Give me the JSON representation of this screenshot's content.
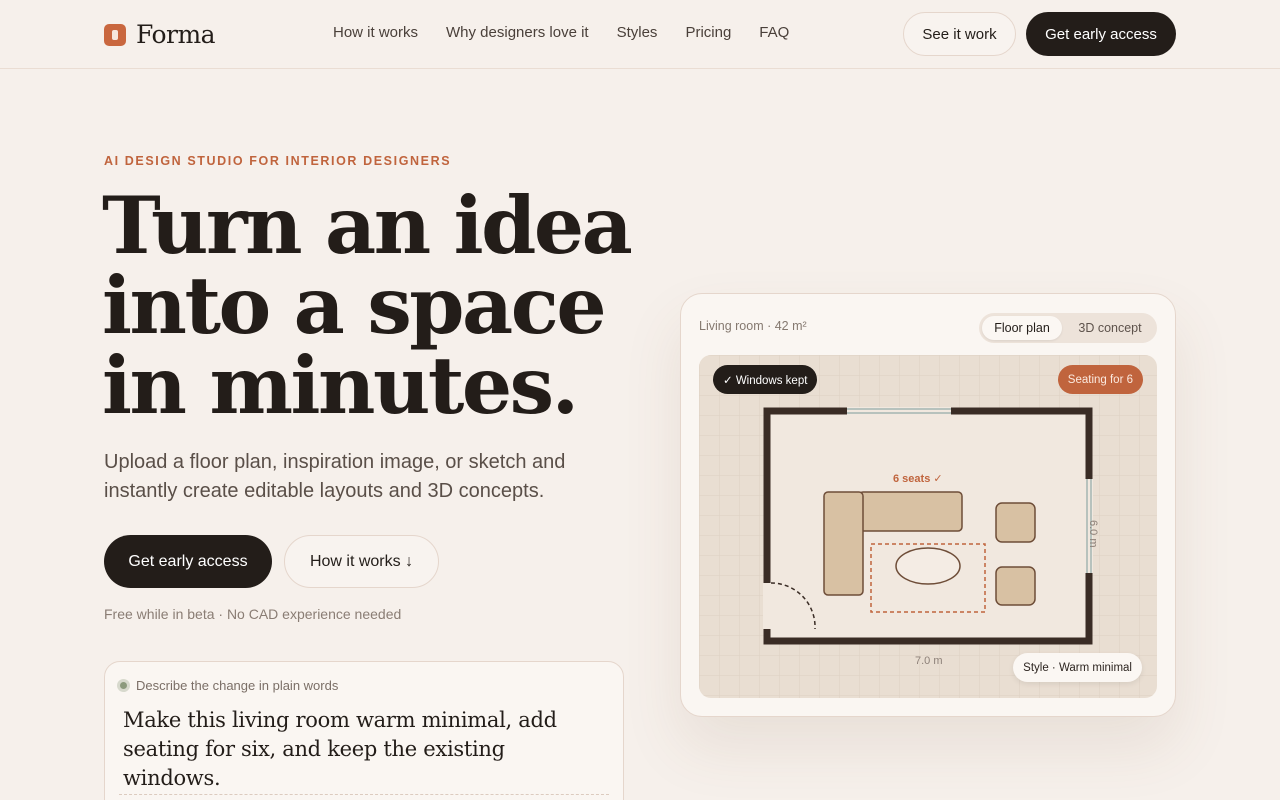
{
  "brand": {
    "name": "Forma"
  },
  "nav": {
    "links": [
      "How it works",
      "Why designers love it",
      "Styles",
      "Pricing",
      "FAQ"
    ],
    "see_it_work": "See it work",
    "cta": "Get early access"
  },
  "hero": {
    "eyebrow": "AI DESIGN STUDIO FOR INTERIOR DESIGNERS",
    "headline": [
      "Turn an idea",
      "into a space",
      "in minutes."
    ],
    "subtitle": "Upload a floor plan, inspiration image, or sketch and instantly create editable layouts and 3D concepts.",
    "primary_cta": "Get early access",
    "secondary_cta": "How it works ↓",
    "note": "Free while in beta · No CAD experience needed"
  },
  "prompt": {
    "label": "Describe the change in plain words",
    "text": "Make this living room warm minimal, add seating for six, and keep the existing windows."
  },
  "preview": {
    "room_label": "Living room · 42 m²",
    "toggle": {
      "active": "Floor plan",
      "inactive": "3D concept"
    },
    "chip_windows": "✓ Windows kept",
    "chip_seating": "Seating for 6",
    "seats_label": "6 seats ✓",
    "dim_width": "7.0 m",
    "dim_height": "6.0 m",
    "chip_style": "Style · Warm minimal"
  },
  "colors": {
    "background": "#f6f0eb",
    "accent": "#c0643d",
    "dark": "#231d19"
  }
}
